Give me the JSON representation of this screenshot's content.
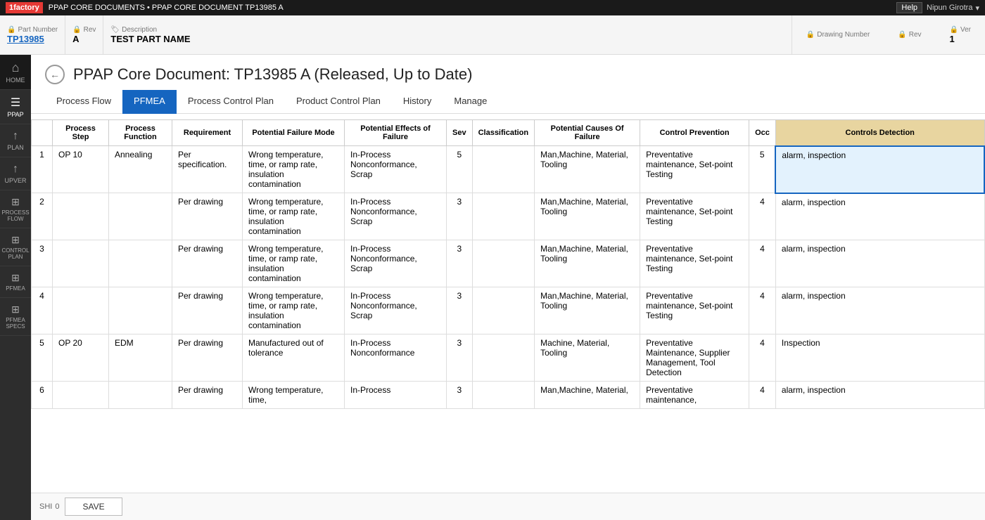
{
  "topbar": {
    "logo": "1factory",
    "breadcrumb": "PPAP CORE DOCUMENTS • PPAP CORE DOCUMENT TP13985 A",
    "help_label": "Help",
    "user": "Nipun Girotra",
    "chevron": "▾"
  },
  "meta": {
    "part_number_label": "Part Number",
    "part_number_value": "TP13985",
    "rev_label": "Rev",
    "rev_value": "A",
    "description_label": "Description",
    "description_value": "TEST PART NAME",
    "drawing_number_label": "Drawing Number",
    "rev_label2": "Rev",
    "ver_label": "Ver",
    "ver_value": "1"
  },
  "page": {
    "title": "PPAP Core Document: TP13985 A (Released, Up to Date)"
  },
  "tabs": [
    {
      "id": "process-flow",
      "label": "Process Flow",
      "active": false
    },
    {
      "id": "pfmea",
      "label": "PFMEA",
      "active": true
    },
    {
      "id": "process-control-plan",
      "label": "Process Control Plan",
      "active": false
    },
    {
      "id": "product-control-plan",
      "label": "Product Control Plan",
      "active": false
    },
    {
      "id": "history",
      "label": "History",
      "active": false
    },
    {
      "id": "manage",
      "label": "Manage",
      "active": false
    }
  ],
  "sidebar": {
    "items": [
      {
        "id": "home",
        "icon": "⌂",
        "label": "HOME"
      },
      {
        "id": "ppap",
        "icon": "≡",
        "label": "PPAP"
      },
      {
        "id": "plan",
        "icon": "↑",
        "label": "PLAN"
      },
      {
        "id": "upver",
        "icon": "↑",
        "label": "UPVER"
      },
      {
        "id": "process-flow",
        "icon": "⊞",
        "label": "PROCESS\nFLOW"
      },
      {
        "id": "control-plan",
        "icon": "⊞",
        "label": "CONTROL\nPLAN"
      },
      {
        "id": "pfmea",
        "icon": "⊞",
        "label": "PFMEA"
      },
      {
        "id": "pfmea-specs",
        "icon": "⊞",
        "label": "PFMEA\nSPECS"
      }
    ]
  },
  "table": {
    "columns": [
      {
        "id": "num",
        "label": ""
      },
      {
        "id": "process-step",
        "label": "Process Step"
      },
      {
        "id": "process-function",
        "label": "Process Function"
      },
      {
        "id": "requirement",
        "label": "Requirement"
      },
      {
        "id": "failure-mode",
        "label": "Potential Failure Mode"
      },
      {
        "id": "effects",
        "label": "Potential Effects of Failure"
      },
      {
        "id": "sev",
        "label": "Sev"
      },
      {
        "id": "classification",
        "label": "Classification"
      },
      {
        "id": "causes",
        "label": "Potential Causes Of Failure"
      },
      {
        "id": "control-prevention",
        "label": "Control Prevention"
      },
      {
        "id": "occ",
        "label": "Occ"
      },
      {
        "id": "controls-detection",
        "label": "Controls Detection"
      }
    ],
    "rows": [
      {
        "num": "1",
        "process_step": "OP 10",
        "process_function": "Annealing",
        "requirement": "Per specification.",
        "failure_mode": "Wrong temperature, time, or ramp rate, insulation contamination",
        "effects": "In-Process Nonconformance, Scrap",
        "sev": "5",
        "classification": "",
        "causes": "Man,Machine, Material, Tooling",
        "control_prevention": "Preventative maintenance, Set-point Testing",
        "occ": "5",
        "controls_detection": "alarm, inspection",
        "highlighted": true
      },
      {
        "num": "2",
        "process_step": "",
        "process_function": "",
        "requirement": "Per drawing",
        "failure_mode": "Wrong temperature, time, or ramp rate, insulation contamination",
        "effects": "In-Process Nonconformance, Scrap",
        "sev": "3",
        "classification": "",
        "causes": "Man,Machine, Material, Tooling",
        "control_prevention": "Preventative maintenance, Set-point Testing",
        "occ": "4",
        "controls_detection": "alarm, inspection",
        "highlighted": false
      },
      {
        "num": "3",
        "process_step": "",
        "process_function": "",
        "requirement": "Per drawing",
        "failure_mode": "Wrong temperature, time, or ramp rate, insulation contamination",
        "effects": "In-Process Nonconformance, Scrap",
        "sev": "3",
        "classification": "",
        "causes": "Man,Machine, Material, Tooling",
        "control_prevention": "Preventative maintenance, Set-point Testing",
        "occ": "4",
        "controls_detection": "alarm, inspection",
        "highlighted": false
      },
      {
        "num": "4",
        "process_step": "",
        "process_function": "",
        "requirement": "Per drawing",
        "failure_mode": "Wrong temperature, time, or ramp rate, insulation contamination",
        "effects": "In-Process Nonconformance, Scrap",
        "sev": "3",
        "classification": "",
        "causes": "Man,Machine, Material, Tooling",
        "control_prevention": "Preventative maintenance, Set-point Testing",
        "occ": "4",
        "controls_detection": "alarm, inspection",
        "highlighted": false
      },
      {
        "num": "5",
        "process_step": "OP 20",
        "process_function": "EDM",
        "requirement": "Per drawing",
        "failure_mode": "Manufactured out of tolerance",
        "effects": "In-Process Nonconformance",
        "sev": "3",
        "classification": "",
        "causes": "Machine, Material, Tooling",
        "control_prevention": "Preventative Maintenance, Supplier Management, Tool Detection",
        "occ": "4",
        "controls_detection": "Inspection",
        "highlighted": false
      },
      {
        "num": "6",
        "process_step": "",
        "process_function": "",
        "requirement": "Per drawing",
        "failure_mode": "Wrong temperature, time,",
        "effects": "In-Process",
        "sev": "3",
        "classification": "",
        "causes": "Man,Machine, Material,",
        "control_prevention": "Preventative maintenance,",
        "occ": "4",
        "controls_detection": "alarm, inspection",
        "highlighted": false
      }
    ]
  },
  "bottombar": {
    "shift_label": "SHI",
    "shift_value": "0",
    "save_label": "SAVE"
  }
}
